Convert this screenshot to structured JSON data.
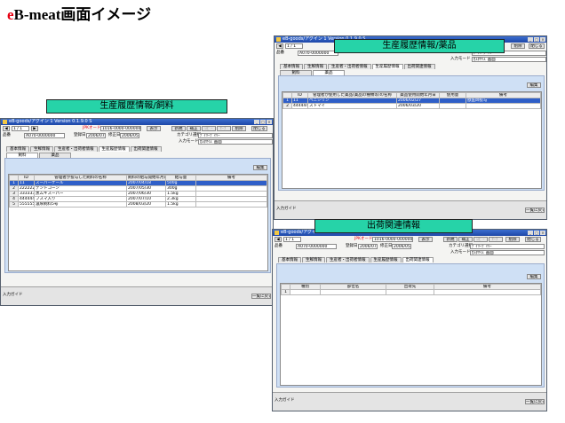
{
  "page": {
    "title_prefix": "e",
    "title_rest": "B-meat画面イメージ"
  },
  "captions": {
    "feed": "生産履歴情報/飼料",
    "medicine": "生産履歴情報/薬品",
    "shipping": "出荷関連情報"
  },
  "window": {
    "title": "eB-goods/アグイン 1 Version 0.1.9.0 S",
    "page_counter": "1 / 1",
    "id_label": "個体識別",
    "id_value": "8701234567",
    "id_code": "JPKオード",
    "record_code": "JR1000-0001",
    "barcode_value": "1016-0000-0000005-0001",
    "btn_display": "表示",
    "btn_new": "新規",
    "btn_edit": "補正",
    "btn_delete": "削除",
    "btn_copy": "ﾛﾋﾟｰ",
    "btn_save": "ｾｰﾌﾞ",
    "btn_close": "閉じる",
    "name_label": "品番",
    "name_value": "A070-0000000",
    "date_label1": "登録日",
    "date_value1": "2006/07/21",
    "date_label2": "修正日",
    "date_value2": "2006/05/29",
    "category_label": "カテゴリ選択",
    "category_value": "ﾃﾞｲﾘｰﾃﾞｲﾘｰ",
    "mode_label": "入力モード",
    "mode_value": "ｶｽﾀﾏｲｽﾞ画面",
    "tabs": [
      "基本情報",
      "生鮮情報",
      "生産者・出荷者情報",
      "生産履歴情報",
      "出荷関連情報"
    ],
    "edit_button": "編集",
    "status_label": "入力ガイド",
    "return_button": "一覧に戻る"
  },
  "feed_window": {
    "subtabs": [
      "飼料",
      "薬品"
    ],
    "columns": [
      "ID",
      "管理者が投与した飼料の名称",
      "飼料の給与開始年月日",
      "給与量",
      "備考"
    ],
    "rows": [
      {
        "num": "1",
        "id": "11",
        "name": "スーパーケール",
        "date": "2007/04/18",
        "amount": "500g",
        "note": "",
        "selected": true
      },
      {
        "num": "2",
        "id": "2222222",
        "name": "デントコーン",
        "date": "2007/05/30",
        "amount": "300g",
        "note": "",
        "selected": false
      },
      {
        "num": "3",
        "id": "333333",
        "name": "黒ムギスーパー",
        "date": "2007/06/30",
        "amount": "1.5kg",
        "note": "",
        "selected": false
      },
      {
        "num": "4",
        "id": "444444",
        "name": "フスマ入り",
        "date": "2007/07/10",
        "amount": "2.3kg",
        "note": "",
        "selected": false
      },
      {
        "num": "5",
        "id": "555555",
        "name": "濃厚飼料5号",
        "date": "2008/03/20",
        "amount": "1.5kg",
        "note": "",
        "selected": false
      }
    ]
  },
  "medicine_window": {
    "subtabs": [
      "飼料",
      "薬品"
    ],
    "columns": [
      "ID",
      "管理者が使用した薬品(薬品の種類等)の名称",
      "薬品使用開始年月日",
      "使用量",
      "備考"
    ],
    "rows": [
      {
        "num": "1",
        "id": "11",
        "name": "ペニシリン",
        "date": "2006/02/27",
        "amount": "",
        "note": "獣医師投与",
        "selected": true
      },
      {
        "num": "2",
        "id": "444444",
        "name": "ストマイ",
        "date": "2006/03/20",
        "amount": "",
        "note": "",
        "selected": false
      }
    ]
  },
  "shipping_window": {
    "columns": [
      "種別",
      "部位名",
      "出荷先",
      "備考"
    ],
    "rows": [
      {
        "num": "1",
        "type": "",
        "part": "",
        "dest": "",
        "note": ""
      }
    ]
  }
}
